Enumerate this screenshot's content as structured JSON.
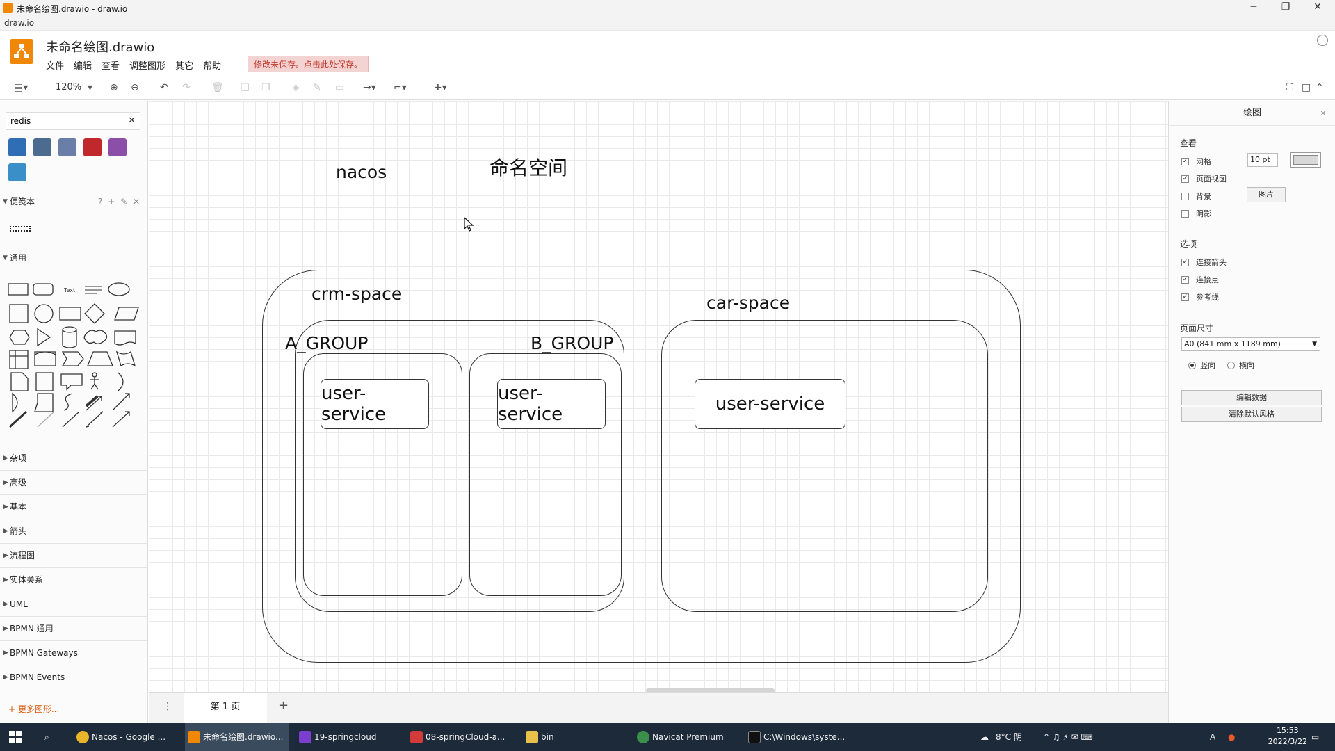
{
  "window": {
    "title": "未命名绘图.drawio - draw.io",
    "app_name": "draw.io",
    "minimize": "─",
    "restore": "❐",
    "close": "✕"
  },
  "header": {
    "doc_title": "未命名绘图.drawio",
    "menus": [
      "文件",
      "编辑",
      "查看",
      "调整图形",
      "其它",
      "帮助"
    ],
    "unsaved_notice": "修改未保存。点击此处保存。"
  },
  "toolbar": {
    "zoom": "120%",
    "view_icon": "sidebar-view-icon",
    "zoom_in_icon": "zoom-in-icon",
    "zoom_out_icon": "zoom-out-icon"
  },
  "sidebar": {
    "search_value": "redis",
    "search_clear": "✕",
    "scratchpad_label": "便笺本",
    "scratchpad_tools": "? + ✎ ✕",
    "general_label": "通用",
    "categories": [
      "杂项",
      "高级",
      "基本",
      "箭头",
      "流程图",
      "实体关系",
      "UML",
      "BPMN 通用",
      "BPMN Gateways",
      "BPMN Events"
    ],
    "more_shapes": "+ 更多图形..."
  },
  "diagram": {
    "title_nacos": "nacos",
    "title_namespace": "命名空间",
    "crm_space": "crm-space",
    "car_space": "car-space",
    "a_group": "A_GROUP",
    "b_group": "B_GROUP",
    "services": [
      "user-service",
      "user-service",
      "user-service"
    ]
  },
  "pages": {
    "tab": "第 1 页",
    "menu": "⋮",
    "add": "+"
  },
  "right_panel": {
    "title": "绘图",
    "close": "✕",
    "view_section": "查看",
    "grid": "网格",
    "grid_size": "10 pt",
    "page_view": "页面视图",
    "background": "背景",
    "image_button": "图片",
    "shadow": "阴影",
    "options_section": "选项",
    "connection_arrows": "连接箭头",
    "connection_points": "连接点",
    "guides": "参考线",
    "page_size_section": "页面尺寸",
    "page_size_value": "A0 (841 mm x 1189 mm)",
    "portrait": "竖向",
    "landscape": "横向",
    "edit_data": "编辑数据",
    "clear_default_style": "清除默认风格",
    "checks": {
      "grid": true,
      "page_view": true,
      "background": false,
      "shadow": false,
      "connection_arrows": true,
      "connection_points": true,
      "guides": true
    }
  },
  "taskbar": {
    "items": [
      "Nacos - Google ...",
      "未命名绘图.drawio...",
      "19-springcloud",
      "08-springCloud-a...",
      "bin",
      "Navicat Premium",
      "C:\\Windows\\syste..."
    ],
    "weather": "8°C 阴",
    "ime": "A",
    "time": "15:53",
    "date": "2022/3/22"
  },
  "colors": {
    "accent": "#f08705",
    "taskbar": "#1d2a3a"
  }
}
